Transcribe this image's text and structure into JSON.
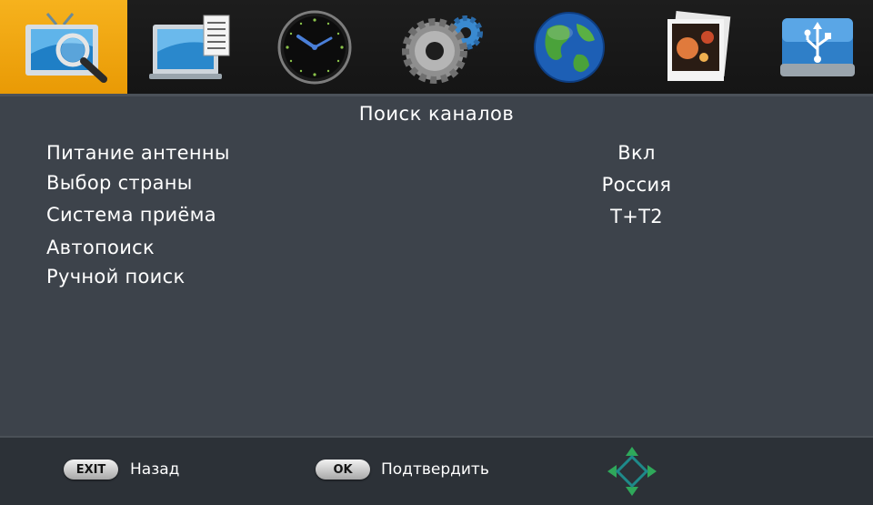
{
  "tabs": [
    {
      "icon": "tv-search-icon",
      "active": true
    },
    {
      "icon": "tv-guide-icon",
      "active": false
    },
    {
      "icon": "clock-icon",
      "active": false
    },
    {
      "icon": "settings-gears-icon",
      "active": false
    },
    {
      "icon": "globe-icon",
      "active": false
    },
    {
      "icon": "photo-media-icon",
      "active": false
    },
    {
      "icon": "usb-drive-icon",
      "active": false
    }
  ],
  "menu": {
    "title": "Поиск каналов",
    "items": [
      {
        "label": "Питание антенны",
        "value": "Вкл"
      },
      {
        "label": "Выбор страны",
        "value": "Россия"
      },
      {
        "label": "Система приёма",
        "value": "T+T2"
      },
      {
        "label": "Автопоиск",
        "value": ""
      },
      {
        "label": "Ручной поиск",
        "value": ""
      }
    ]
  },
  "footer": {
    "exit_key": "EXIT",
    "exit_label": "Назад",
    "ok_key": "OK",
    "ok_label": "Подтвердить",
    "nav_icon": "navigation-arrows-icon"
  },
  "colors": {
    "active_tab": "#f0a512",
    "panel": "#3d434b",
    "topbar": "#1a1a1a",
    "footer": "#2c3137",
    "nav_arrows": "#2fa85a"
  }
}
